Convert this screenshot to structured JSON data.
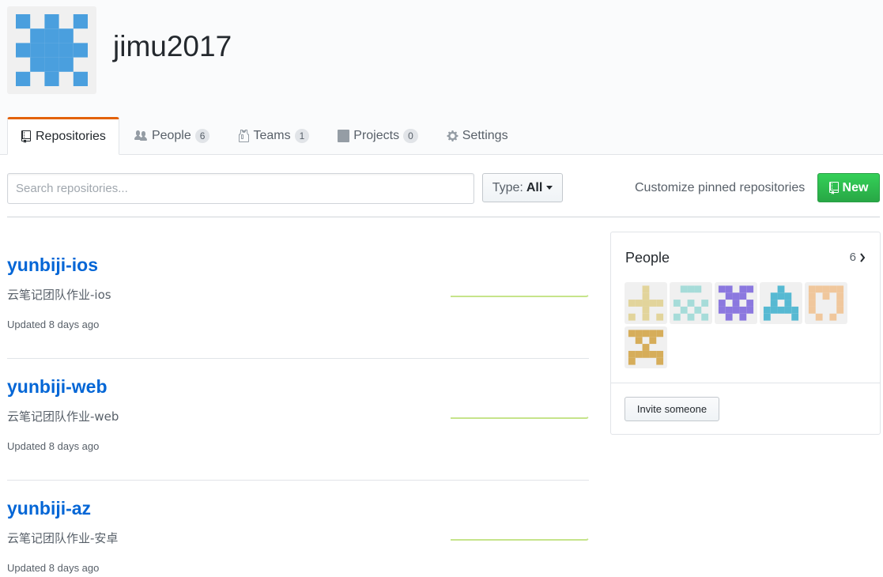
{
  "org": {
    "name": "jimu2017",
    "avatar_color": "#4a9fde"
  },
  "tabs": [
    {
      "label": "Repositories",
      "icon": "repo-icon",
      "selected": true
    },
    {
      "label": "People",
      "icon": "people-icon",
      "count": "6"
    },
    {
      "label": "Teams",
      "icon": "jersey-icon",
      "count": "1"
    },
    {
      "label": "Projects",
      "icon": "project-icon",
      "count": "0"
    },
    {
      "label": "Settings",
      "icon": "gear-icon"
    }
  ],
  "toolbar": {
    "search_placeholder": "Search repositories...",
    "type_label": "Type:",
    "type_value": "All",
    "customize_label": "Customize pinned repositories",
    "new_label": "New"
  },
  "repos": [
    {
      "name": "yunbiji-ios",
      "description": "云笔记团队作业-ios",
      "updated": "Updated 8 days ago"
    },
    {
      "name": "yunbiji-web",
      "description": "云笔记团队作业-web",
      "updated": "Updated 8 days ago"
    },
    {
      "name": "yunbiji-az",
      "description": "云笔记团队作业-安卓",
      "updated": "Updated 8 days ago"
    }
  ],
  "people_box": {
    "title": "People",
    "count": "6",
    "invite_label": "Invite someone",
    "avatar_colors": [
      "#e2d49b",
      "#a6dcd9",
      "#8b78df",
      "#56b9d2",
      "#f0c79c",
      "#d6ad5a"
    ]
  },
  "colors": {
    "accent": "#0366d6",
    "tab_highlight": "#e36209",
    "new_button": "#28a745",
    "sparkline": "#c6e48b"
  }
}
